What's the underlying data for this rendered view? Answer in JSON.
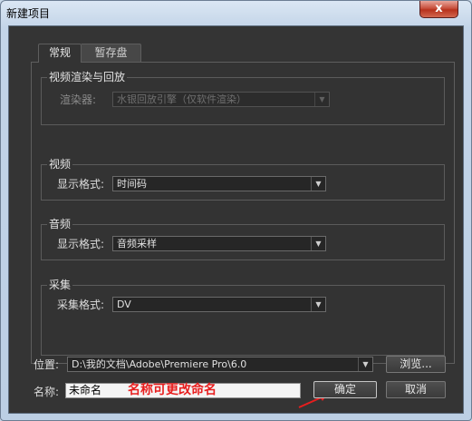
{
  "window": {
    "title": "新建项目",
    "close_glyph": "x"
  },
  "tabs": [
    {
      "label": "常规",
      "active": true
    },
    {
      "label": "暂存盘",
      "active": false
    }
  ],
  "groups": {
    "playback": {
      "title": "视频渲染与回放",
      "renderer_label": "渲染器:",
      "renderer_value": "水银回放引擎（仅软件渲染）",
      "disabled": true
    },
    "video": {
      "title": "视频",
      "display_format_label": "显示格式:",
      "display_format_value": "时间码"
    },
    "audio": {
      "title": "音频",
      "display_format_label": "显示格式:",
      "display_format_value": "音频采样"
    },
    "capture": {
      "title": "采集",
      "capture_format_label": "采集格式:",
      "capture_format_value": "DV"
    }
  },
  "location": {
    "label": "位置:",
    "value": "D:\\我的文档\\Adobe\\Premiere Pro\\6.0",
    "browse_label": "浏览..."
  },
  "name": {
    "label": "名称:",
    "value": "未命名"
  },
  "annotation": {
    "text": "名称可更改命名",
    "color": "#e81e1e"
  },
  "buttons": {
    "ok_label": "确定",
    "cancel_label": "取消"
  },
  "colors": {
    "panel_bg": "#343434",
    "window_chrome": "#c3d4e8",
    "close_button": "#c8503d"
  }
}
